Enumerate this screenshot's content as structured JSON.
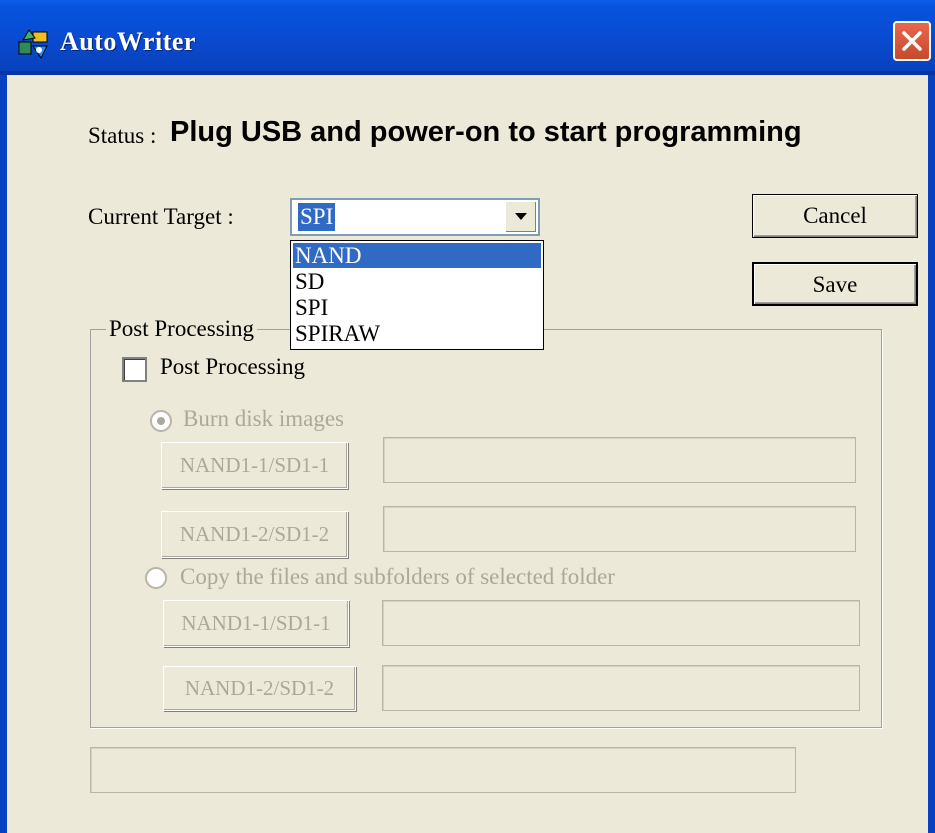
{
  "window": {
    "title": "AutoWriter"
  },
  "status": {
    "label": "Status :",
    "message": "Plug USB and power-on to start programming"
  },
  "target": {
    "label": "Current Target :",
    "selected": "SPI",
    "options": [
      {
        "label": "NAND",
        "highlighted": true
      },
      {
        "label": "SD",
        "highlighted": false
      },
      {
        "label": "SPI",
        "highlighted": false
      },
      {
        "label": "SPIRAW",
        "highlighted": false
      }
    ]
  },
  "buttons": {
    "cancel": "Cancel",
    "save": "Save"
  },
  "post_processing": {
    "group_title": "Post Processing",
    "checkbox_label": "Post Processing",
    "checked": false,
    "burn": {
      "label": "Burn disk images",
      "selected": true,
      "button1": "NAND1-1/SD1-1",
      "field1": "",
      "button2": "NAND1-2/SD1-2",
      "field2": ""
    },
    "copy": {
      "label": "Copy the files and subfolders of selected folder",
      "selected": false,
      "button1": "NAND1-1/SD1-1",
      "field1": "",
      "button2": "NAND1-2/SD1-2",
      "field2": ""
    }
  },
  "progress": {
    "value": 0
  },
  "colors": {
    "titlebar": "#0a4bd2",
    "window_bg": "#ece9d8",
    "selection": "#316ac5",
    "disabled_text": "#aca899"
  }
}
